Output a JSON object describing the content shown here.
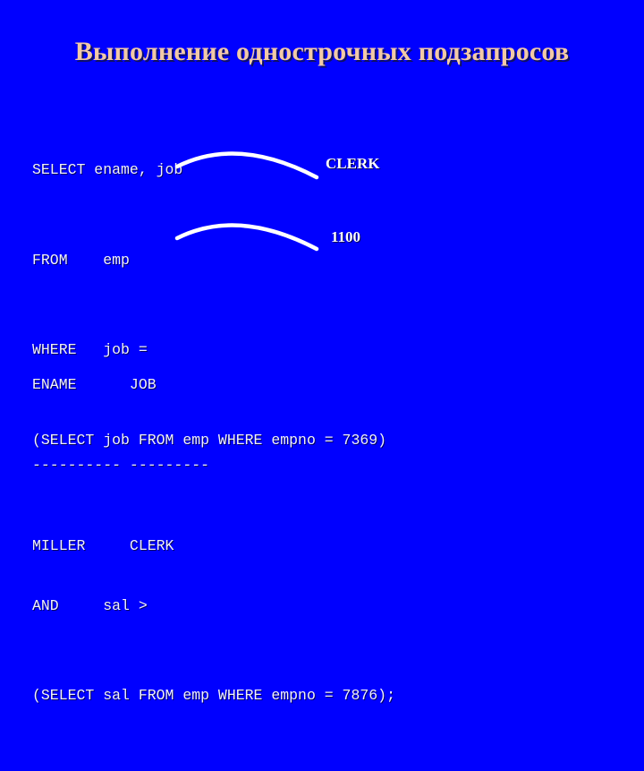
{
  "slide": {
    "title": "Выполнение однострочных подзапросов",
    "background_color": "#0000FF",
    "title_color": "#F2C9A6",
    "code_color": "#F0F0FF",
    "arc_color": "#FFFFFF"
  },
  "code": {
    "lines": [
      "SELECT ename, job",
      "FROM    emp",
      "WHERE   job = ",
      "(SELECT job FROM emp WHERE empno = 7369)",
      "",
      "AND     sal > ",
      "(SELECT sal FROM emp WHERE empno = 7876);"
    ]
  },
  "callouts": [
    {
      "name": "clerk",
      "label": "CLERK",
      "attached_to": "WHERE   job = "
    },
    {
      "name": "value-1100",
      "label": "1100",
      "attached_to": "AND     sal > "
    }
  ],
  "results": {
    "header": "ENAME      JOB",
    "separator": "---------- ---------",
    "columns": [
      "ENAME",
      "JOB"
    ],
    "rows": [
      {
        "line": "MILLER     CLERK",
        "ENAME": "MILLER",
        "JOB": "CLERK"
      }
    ]
  }
}
